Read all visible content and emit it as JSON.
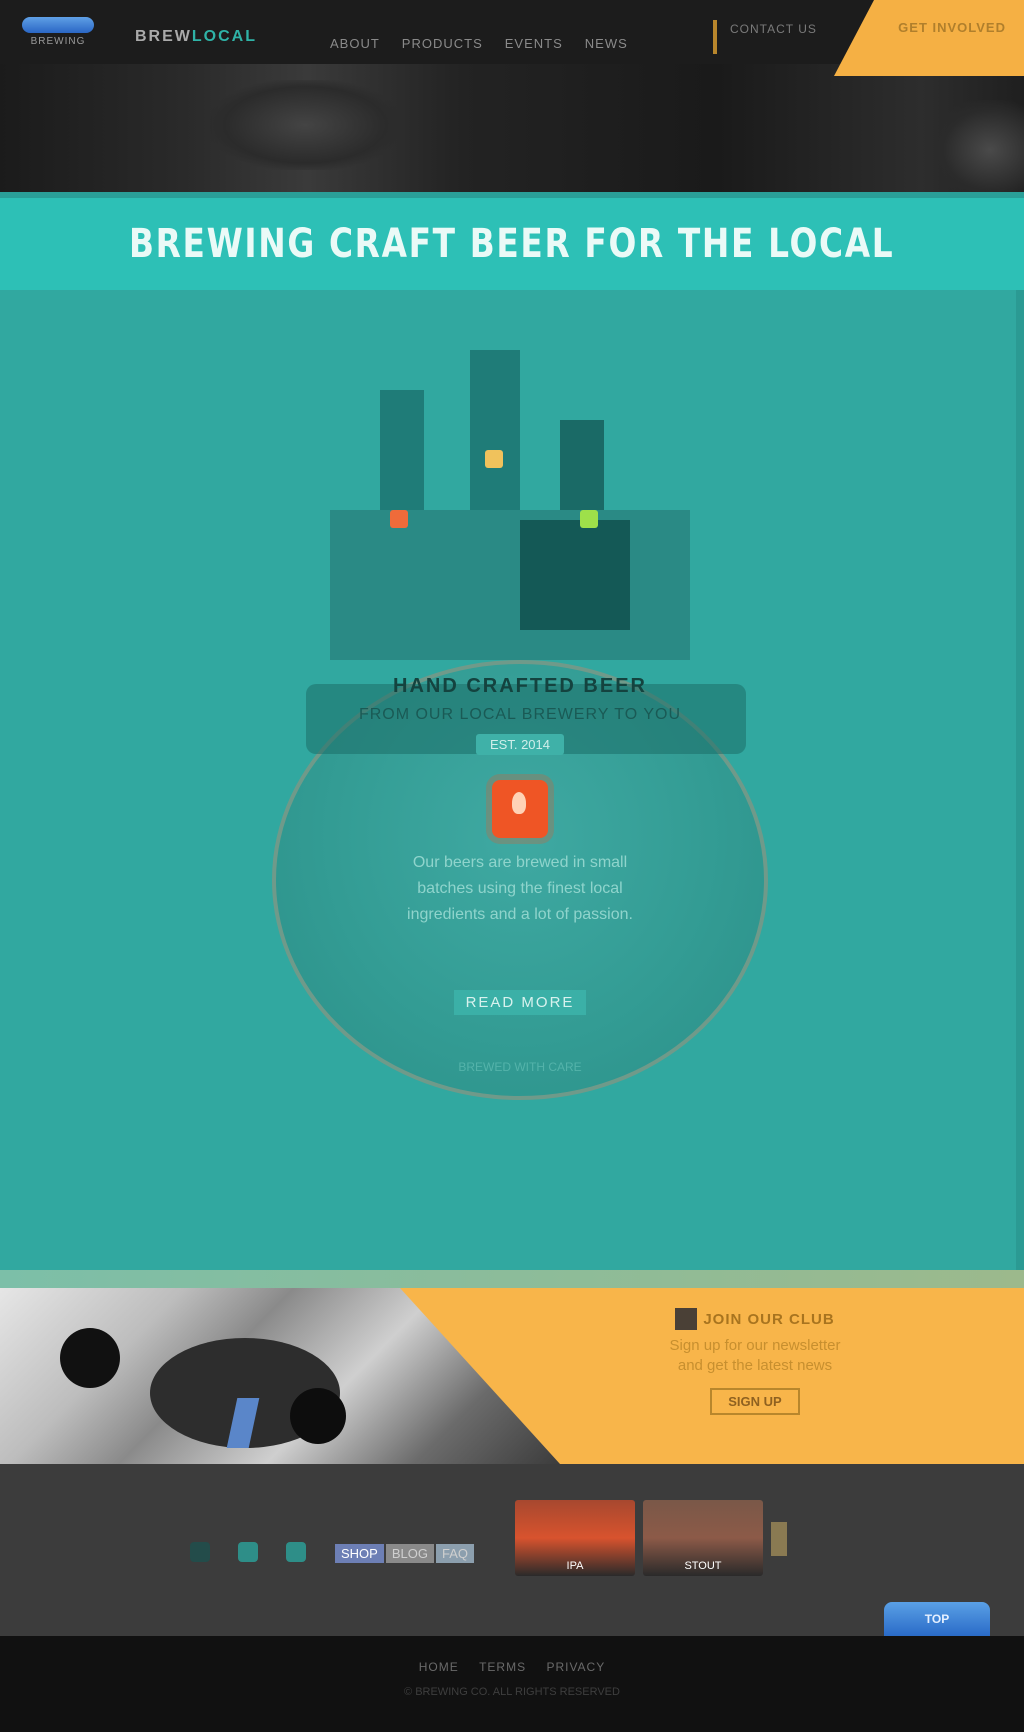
{
  "header": {
    "logo_text": "BREWING",
    "brand_prefix": "BREW",
    "brand_suffix": "LOCAL",
    "nav": [
      "ABOUT",
      "PRODUCTS",
      "EVENTS",
      "NEWS"
    ],
    "secondary_nav": "CONTACT US",
    "cta_label": "GET INVOLVED"
  },
  "title_bar": {
    "title": "BREWING CRAFT BEER FOR THE LOCAL"
  },
  "illustration": {
    "heading_line1": "HAND CRAFTED BEER",
    "heading_line2": "FROM OUR LOCAL BREWERY TO YOU",
    "badge": "EST. 2014",
    "body": [
      "Our beers are brewed in small",
      "batches using the finest local",
      "ingredients and a lot of passion."
    ],
    "cta_label": "READ MORE",
    "footnote": "BREWED WITH CARE"
  },
  "promo": {
    "title": "JOIN OUR CLUB",
    "desc_line1": "Sign up for our newsletter",
    "desc_line2": "and get the latest news",
    "button_label": "SIGN UP"
  },
  "footer": {
    "social_icons": [
      "twitter-icon",
      "facebook-icon",
      "instagram-icon"
    ],
    "pill_links": [
      "SHOP",
      "BLOG",
      "FAQ"
    ],
    "thumbs": [
      "IPA",
      "STOUT"
    ],
    "back_to_top": "TOP",
    "links": [
      "HOME",
      "TERMS",
      "PRIVACY"
    ],
    "copyright": "© BREWING CO. ALL RIGHTS RESERVED"
  },
  "colors": {
    "teal": "#31a8a0",
    "teal_light": "#2dc0b6",
    "orange": "#f8b54a",
    "accent_red": "#ef5525",
    "accent_blue": "#2a66c4",
    "dark": "#1c1c1c"
  }
}
